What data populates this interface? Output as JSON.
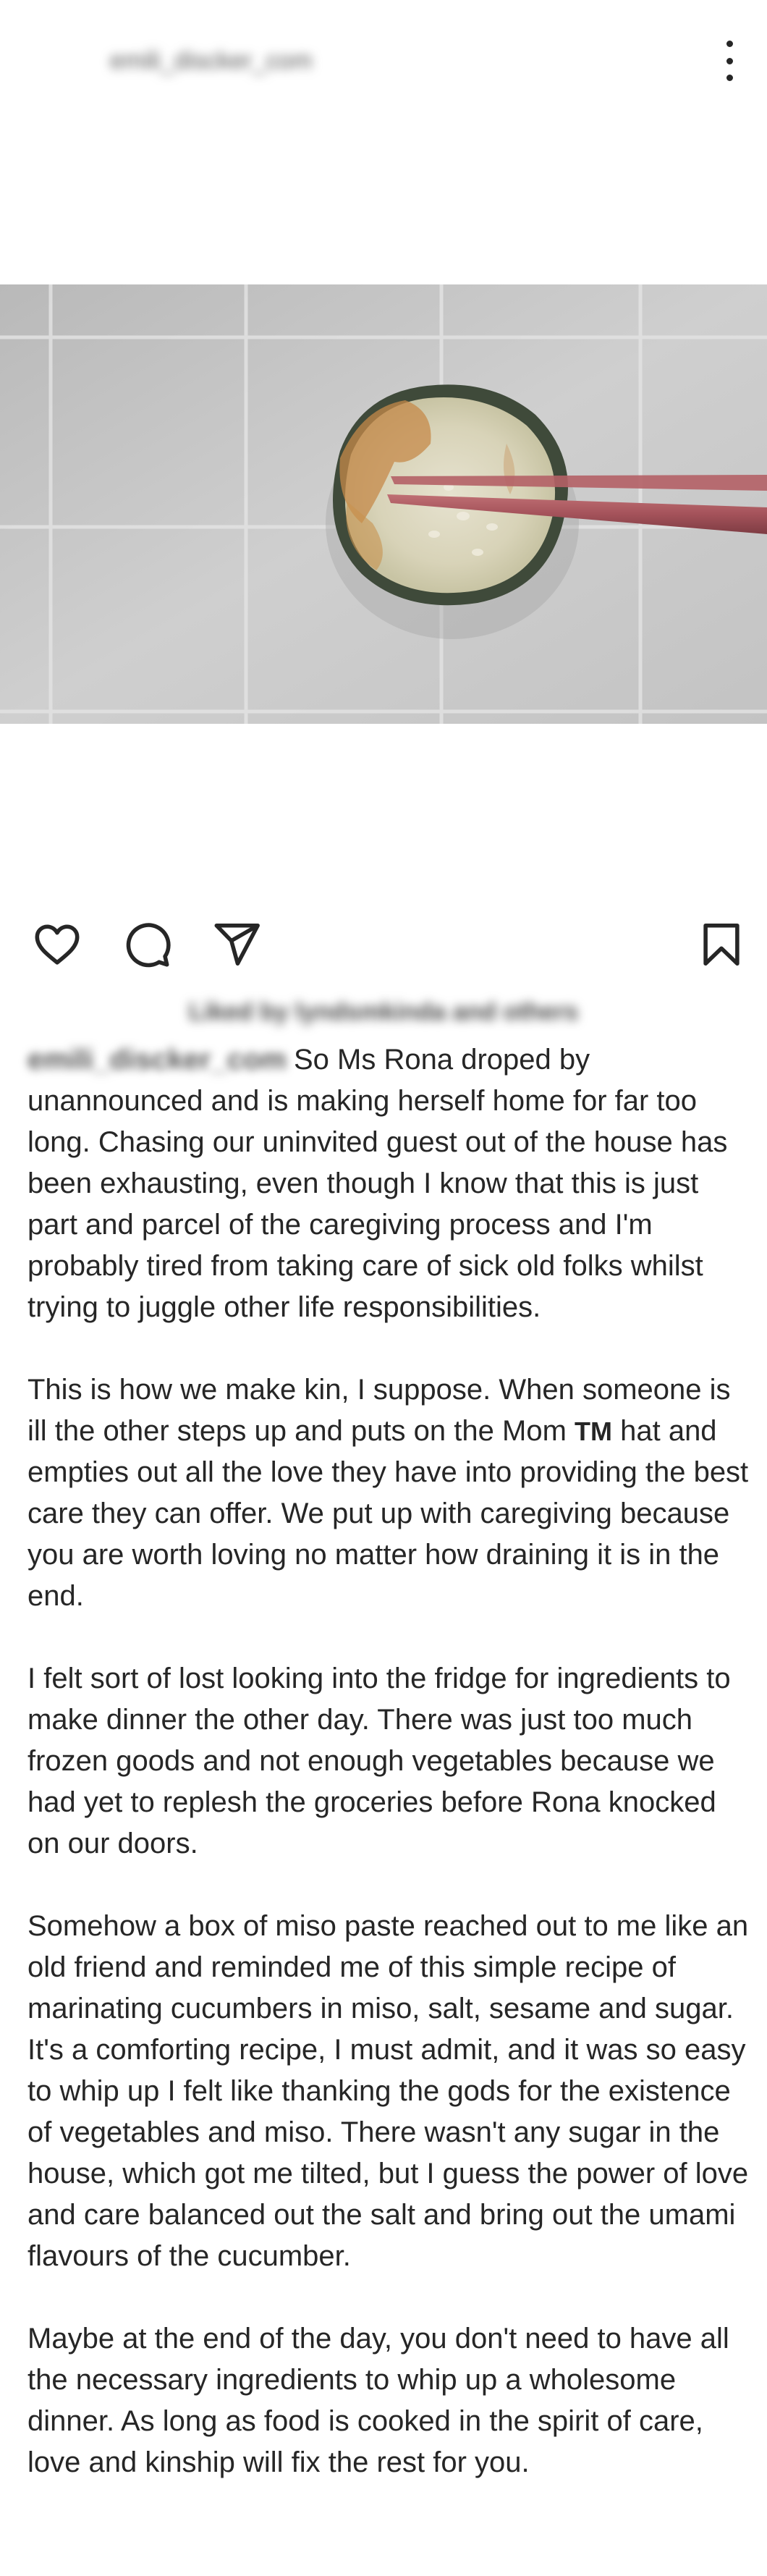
{
  "header": {
    "username": "emili_discker_com"
  },
  "post": {
    "photo_icon": "cucumber-slice-with-chopsticks",
    "liked_by": "Liked by lyndsmkinda and others",
    "caption_username": "emili_discker_com"
  },
  "caption": {
    "p1": "So Ms Rona droped by unannounced and is making herself home for far too long. Chasing our uninvited guest out of the house has been exhausting, even though I know that this is just part and parcel of the caregiving process and I'm probably tired from taking care of sick old folks whilst trying to juggle other life responsibilities.",
    "p2_before": "This is how we make kin, I suppose. When someone is ill the other steps up and puts on the Mom ",
    "p2_tm": "TM",
    "p2_after": " hat and empties out all the love they have into providing the best care they can offer. We put up with caregiving because you are worth loving no matter how draining it is in the end.",
    "p3": "I felt sort of lost looking into the fridge for ingredients to make dinner the other day. There was just too much frozen goods and not enough vegetables because we had yet to replesh the groceries before Rona knocked on our doors.",
    "p4": "Somehow a box of miso paste reached out to me like an old friend and reminded me of this simple recipe of marinating cucumbers in miso, salt, sesame and sugar. It's a comforting recipe, I must admit, and it was so easy to whip up I felt like thanking the gods for the existence of vegetables and miso. There wasn't any sugar in the house, which got me tilted, but I guess the power of love and care balanced out the salt and bring out the umami flavours of the cucumber.",
    "p5": "Maybe at the end of the day, you don't need to have all the necessary ingredients to whip up a wholesome dinner. As long as food is cooked in the spirit of care, love and kinship will fix the rest for you."
  },
  "icons": {
    "more": "more-vertical-icon",
    "like": "heart-icon",
    "comment": "comment-icon",
    "share": "paper-plane-icon",
    "save": "bookmark-icon"
  },
  "colors": {
    "text": "#262626",
    "chopstick": "#a8555b",
    "cucumber_skin": "#3f4a3a",
    "wall": "#c9c9c9"
  }
}
